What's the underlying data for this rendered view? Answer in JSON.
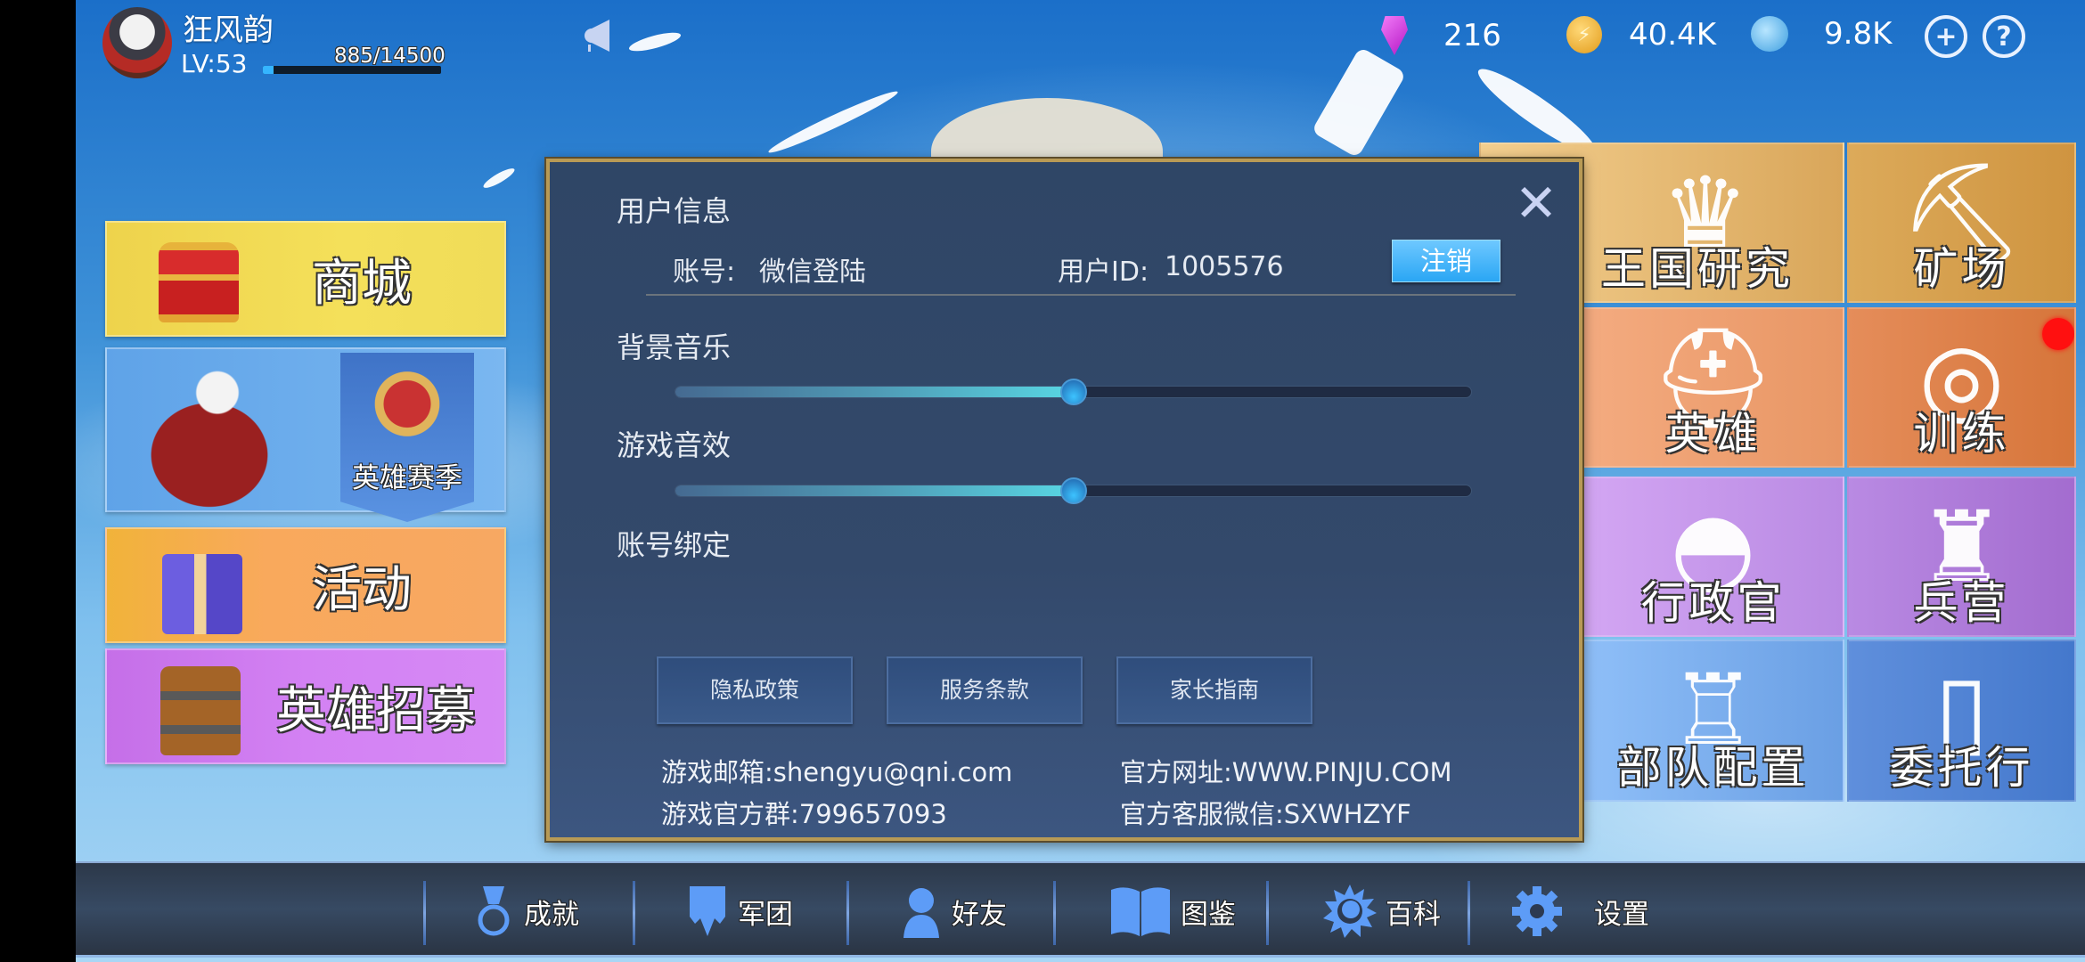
{
  "player": {
    "name": "狂风韵",
    "level_label": "LV:53",
    "xp_text": "885/14500",
    "xp_current": 885,
    "xp_max": 14500
  },
  "resources": [
    {
      "name": "gem",
      "value": "216"
    },
    {
      "name": "gold",
      "value": "40.4K"
    },
    {
      "name": "soul",
      "value": "9.8K"
    }
  ],
  "top_buttons": {
    "add": "+",
    "help": "?"
  },
  "left_menu": {
    "shop": "商城",
    "season": "英雄赛季",
    "event": "活动",
    "recruit": "英雄招募"
  },
  "tiles": [
    {
      "label": "王国研究",
      "icon": "♛"
    },
    {
      "label": "矿场",
      "icon": "⛏"
    },
    {
      "label": "英雄",
      "icon": "⛑"
    },
    {
      "label": "训练",
      "icon": "◎"
    },
    {
      "label": "行政官",
      "icon": "◓"
    },
    {
      "label": "兵营",
      "icon": "♜"
    },
    {
      "label": "部队配置",
      "icon": "♖"
    },
    {
      "label": "委托行",
      "icon": "▯"
    }
  ],
  "dialog": {
    "title": "用户信息",
    "close": "✕",
    "account_label": "账号:",
    "account_value": "微信登陆",
    "uid_label": "用户ID:",
    "uid_value": "1005576",
    "logout": "注销",
    "music_label": "背景音乐",
    "music_volume": 0.5,
    "sfx_label": "游戏音效",
    "sfx_volume": 0.5,
    "binding_label": "账号绑定",
    "links": [
      "隐私政策",
      "服务条款",
      "家长指南"
    ],
    "email": "游戏邮箱:shengyu@qni.com",
    "website": "官方网址:WWW.PINJU.COM",
    "group": "游戏官方群:799657093",
    "wechat": "官方客服微信:SXWHZYF"
  },
  "bottom_nav": [
    {
      "label": "成就",
      "icon": "medal-icon"
    },
    {
      "label": "军团",
      "icon": "banner-icon"
    },
    {
      "label": "好友",
      "icon": "friend-icon"
    },
    {
      "label": "图鉴",
      "icon": "book-icon"
    },
    {
      "label": "百科",
      "icon": "sun-icon"
    },
    {
      "label": "设置",
      "icon": "gear-icon"
    }
  ],
  "colors": {
    "dialog_bg": "#33496b",
    "dialog_border": "#b89a55",
    "accent_blue": "#2aa6f4",
    "slider_fill": "#58d6e3",
    "notification": "#ff1010"
  }
}
